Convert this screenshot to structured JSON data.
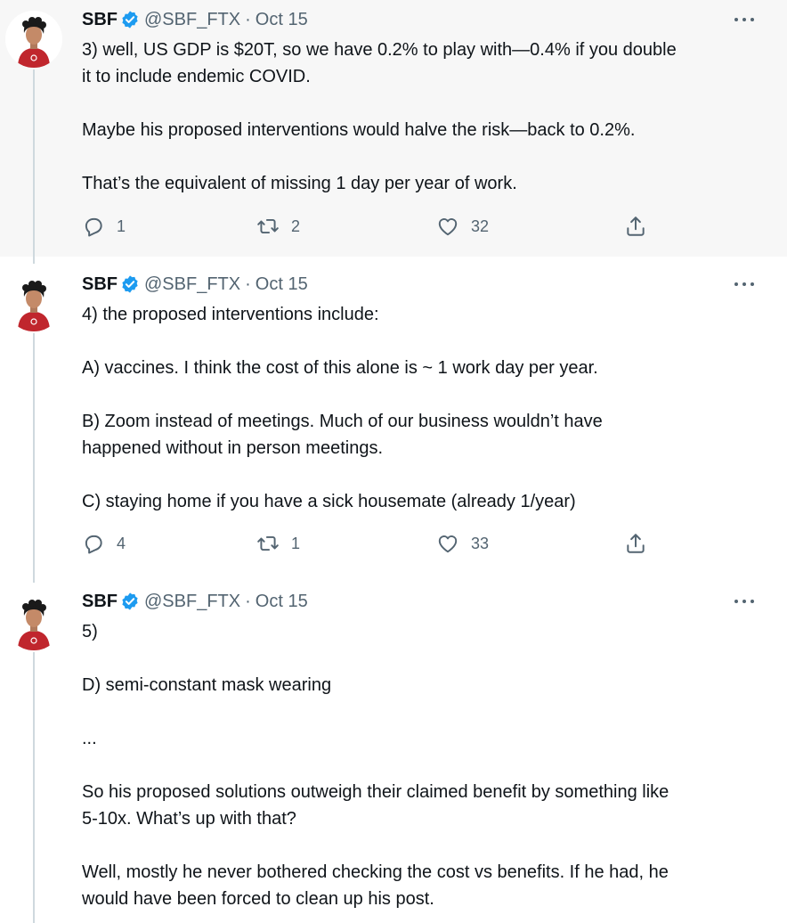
{
  "author": {
    "name": "SBF",
    "handle": "@SBF_FTX",
    "separator": "·",
    "avatar_icon": "avatar-person-red-shirt",
    "verified_icon": "verified-badge-icon",
    "verified_color": "#1d9bf0"
  },
  "colors": {
    "text": "#0f1419",
    "muted": "#536471",
    "thread_line": "#cfd9de",
    "highlight_bg": "#f7f7f7"
  },
  "tweets": [
    {
      "date": "Oct 15",
      "lines": [
        "3) well, US GDP is $20T, so we have 0.2% to play with—0.4% if you double",
        "it to include endemic COVID.",
        "",
        "Maybe his proposed interventions would halve the risk—back to 0.2%.",
        "",
        "That’s the equivalent of missing 1 day per year of work."
      ],
      "replies": "1",
      "retweets": "2",
      "likes": "32"
    },
    {
      "date": "Oct 15",
      "lines": [
        "4) the proposed interventions include:",
        "",
        "A) vaccines.  I think the cost of this alone is ~ 1 work day per year.",
        "",
        "B) Zoom instead of meetings.  Much of our business wouldn’t have",
        "happened without in person meetings.",
        "",
        "C) staying home if you have a sick housemate (already 1/year)"
      ],
      "replies": "4",
      "retweets": "1",
      "likes": "33"
    },
    {
      "date": "Oct 15",
      "lines": [
        "5)",
        "",
        "D) semi-constant mask wearing",
        "",
        "...",
        "",
        "So his proposed solutions outweigh their claimed benefit by something like",
        "5-10x.  What’s up with that?",
        "",
        "Well, mostly he never bothered checking the cost vs benefits.  If he had, he",
        "would have been forced to clean up his post."
      ]
    }
  ]
}
